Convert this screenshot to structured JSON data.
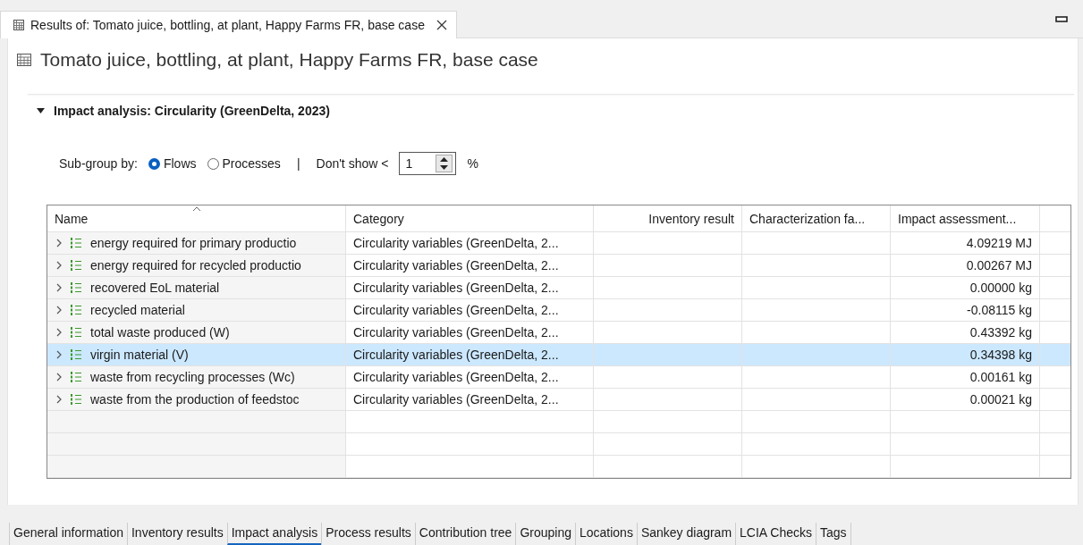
{
  "editor_tab": {
    "title": "Results of: Tomato juice, bottling, at plant, Happy Farms FR, base case"
  },
  "page_title": "Tomato juice, bottling, at plant, Happy Farms FR, base case",
  "section": {
    "title": "Impact analysis: Circularity (GreenDelta, 2023)",
    "expanded": true
  },
  "controls": {
    "subgroup_label": "Sub-group by:",
    "options": [
      {
        "label": "Flows",
        "selected": true
      },
      {
        "label": "Processes",
        "selected": false
      }
    ],
    "separator": "|",
    "threshold_label": "Don't show <",
    "threshold_value": "1",
    "unit": "%"
  },
  "table": {
    "columns": [
      "Name",
      "Category",
      "Inventory result",
      "Characterization fa...",
      "Impact assessment..."
    ],
    "rows": [
      {
        "name": "energy required for primary productio",
        "category": "Circularity variables (GreenDelta, 2...",
        "inventory": "",
        "factor": "",
        "impact": "4.09219 MJ",
        "selected": false
      },
      {
        "name": "energy required for recycled productio",
        "category": "Circularity variables (GreenDelta, 2...",
        "inventory": "",
        "factor": "",
        "impact": "0.00267 MJ",
        "selected": false
      },
      {
        "name": "recovered EoL material",
        "category": "Circularity variables (GreenDelta, 2...",
        "inventory": "",
        "factor": "",
        "impact": "0.00000 kg",
        "selected": false
      },
      {
        "name": "recycled material",
        "category": "Circularity variables (GreenDelta, 2...",
        "inventory": "",
        "factor": "",
        "impact": "-0.08115 kg",
        "selected": false
      },
      {
        "name": "total waste produced (W)",
        "category": "Circularity variables (GreenDelta, 2...",
        "inventory": "",
        "factor": "",
        "impact": "0.43392 kg",
        "selected": false
      },
      {
        "name": "virgin material (V)",
        "category": "Circularity variables (GreenDelta, 2...",
        "inventory": "",
        "factor": "",
        "impact": "0.34398 kg",
        "selected": true
      },
      {
        "name": "waste from recycling processes (Wc)",
        "category": "Circularity variables (GreenDelta, 2...",
        "inventory": "",
        "factor": "",
        "impact": "0.00161 kg",
        "selected": false
      },
      {
        "name": "waste from the production of feedstoc",
        "category": "Circularity variables (GreenDelta, 2...",
        "inventory": "",
        "factor": "",
        "impact": "0.00021 kg",
        "selected": false
      }
    ]
  },
  "bottom_tabs": [
    {
      "label": "General information",
      "selected": false
    },
    {
      "label": "Inventory results",
      "selected": false
    },
    {
      "label": "Impact analysis",
      "selected": true
    },
    {
      "label": "Process results",
      "selected": false
    },
    {
      "label": "Contribution tree",
      "selected": false
    },
    {
      "label": "Grouping",
      "selected": false
    },
    {
      "label": "Locations",
      "selected": false
    },
    {
      "label": "Sankey diagram",
      "selected": false
    },
    {
      "label": "LCIA Checks",
      "selected": false
    },
    {
      "label": "Tags",
      "selected": false
    }
  ]
}
